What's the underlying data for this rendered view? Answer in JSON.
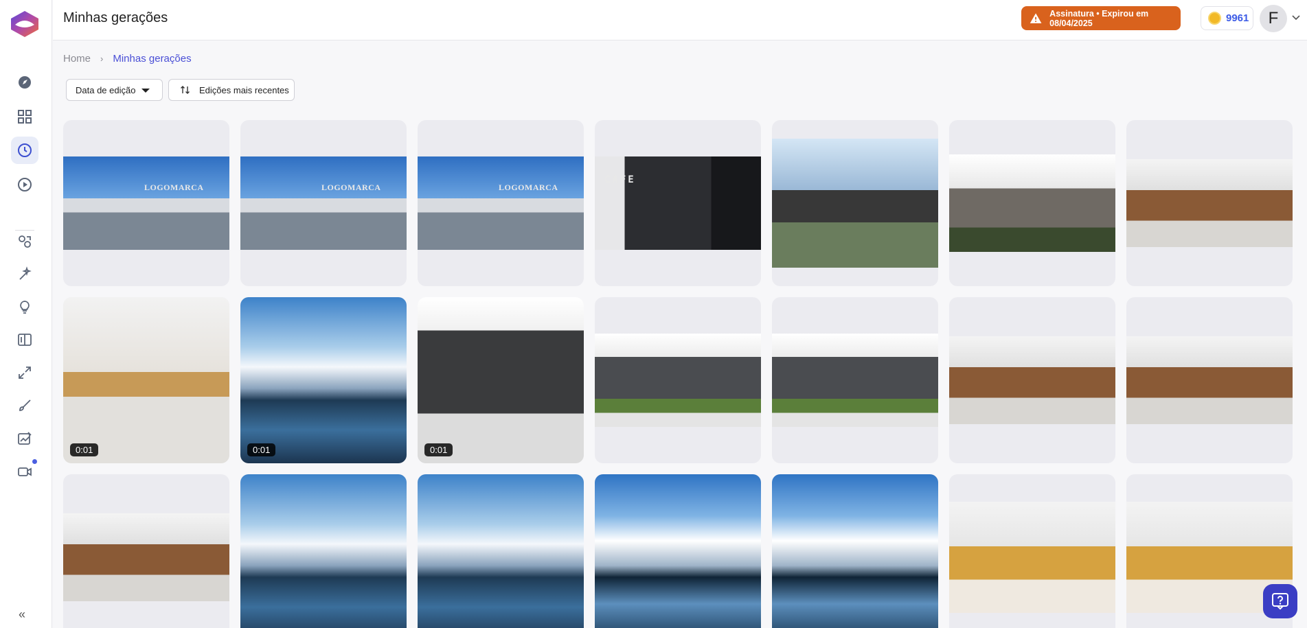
{
  "header": {
    "title": "Minhas gerações",
    "subscription_alert": "Assinatura • Expirou em 08/04/2025",
    "credits": "9961",
    "avatar_initial": "F"
  },
  "breadcrumb": {
    "home": "Home",
    "separator": "›",
    "current": "Minhas gerações"
  },
  "filters": {
    "date_label": "Data de edição",
    "sort_label": "Edições mais recentes"
  },
  "sidebar": {
    "items": [
      {
        "icon": "compass-icon"
      },
      {
        "icon": "grid-icon"
      },
      {
        "icon": "clock-icon",
        "active": true
      },
      {
        "icon": "play-icon"
      },
      {
        "icon": "render-icon"
      },
      {
        "icon": "magic-icon"
      },
      {
        "icon": "lightbulb-icon"
      },
      {
        "icon": "compare-icon"
      },
      {
        "icon": "expand-icon"
      },
      {
        "icon": "brush-icon"
      },
      {
        "icon": "edit-image-icon"
      },
      {
        "icon": "video-icon",
        "has_badge": true
      }
    ],
    "collapse_label": "«"
  },
  "gallery": {
    "rows": [
      [
        {
          "scene": "logomarca-wall",
          "image_text": "LOGOMARCA"
        },
        {
          "scene": "logomarca-wall",
          "image_text": "LOGOMARCA"
        },
        {
          "scene": "logomarca-wall",
          "image_text": "LOGOMARCA"
        },
        {
          "scene": "cafe-front",
          "image_text": "CAFE"
        },
        {
          "scene": "modern-house"
        },
        {
          "scene": "white-house"
        },
        {
          "scene": "wood-villa"
        }
      ],
      [
        {
          "scene": "kitchen",
          "duration": "0:01"
        },
        {
          "scene": "mountain-lake",
          "duration": "0:01"
        },
        {
          "scene": "apartment-building",
          "duration": "0:01"
        },
        {
          "scene": "apartment-building"
        },
        {
          "scene": "apartment-building"
        },
        {
          "scene": "wood-villa"
        },
        {
          "scene": "wood-villa"
        }
      ],
      [
        {
          "scene": "wood-villa"
        },
        {
          "scene": "mountain-lake"
        },
        {
          "scene": "mountain-lake"
        },
        {
          "scene": "mountain-lake"
        },
        {
          "scene": "mountain-lake"
        },
        {
          "scene": "kitchen-yellow"
        },
        {
          "scene": "kitchen-yellow"
        }
      ]
    ]
  },
  "colors": {
    "accent": "#4a4fd6",
    "alert": "#d9621d",
    "help_button": "#3b3ec4"
  }
}
